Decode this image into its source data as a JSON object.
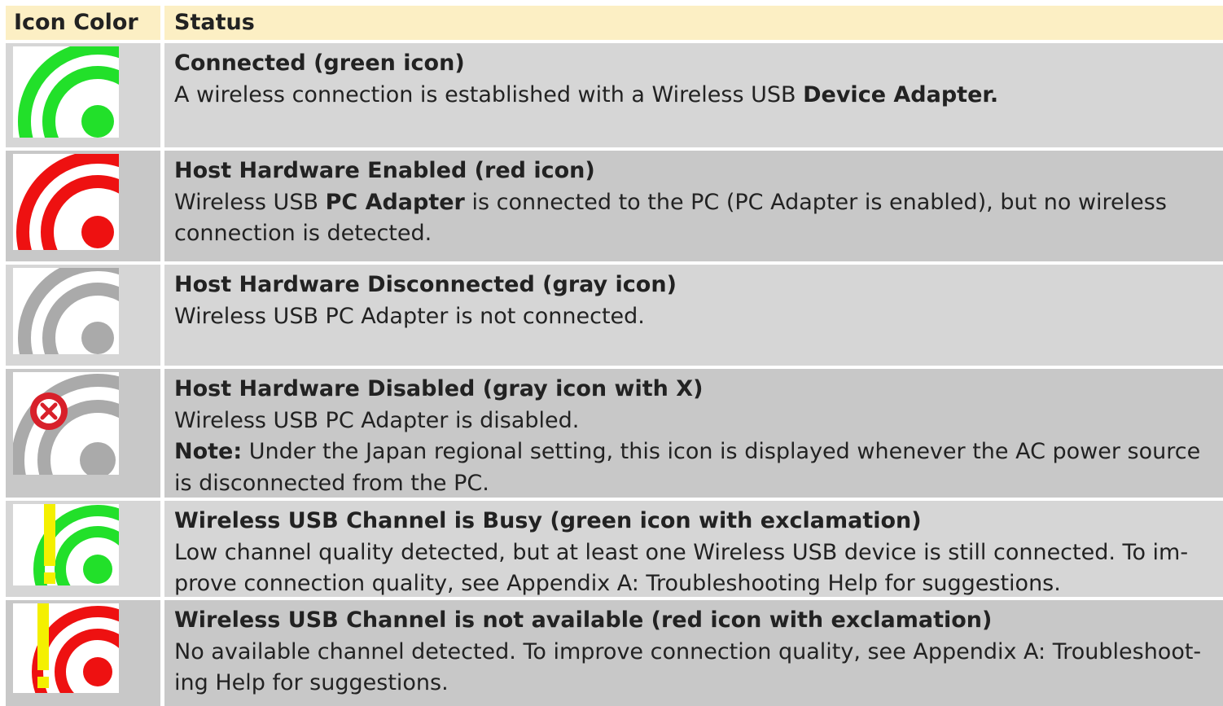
{
  "header": {
    "col1": "Icon Color",
    "col2": "Status"
  },
  "colors": {
    "green": "#22e02a",
    "red": "#ee1111",
    "gray": "#aaaaaa",
    "yellow": "#f4f000",
    "header_bg": "#fcefc4"
  },
  "rows": [
    {
      "icon": "green-wireless-icon",
      "title": "Connected (green icon)",
      "desc_a": "A wireless connection is established with a Wireless USB ",
      "desc_b": "Device Adapter."
    },
    {
      "icon": "red-wireless-icon",
      "title": "Host Hardware Enabled (red icon)",
      "desc_a": "Wireless USB ",
      "desc_b": "PC Adapter",
      "desc_c": " is connected to the PC (PC Adapter is enabled), but no wireless connection is detected."
    },
    {
      "icon": "gray-wireless-icon",
      "title": "Host Hardware Disconnected (gray icon)",
      "desc_a": "Wireless USB PC Adapter is not connected."
    },
    {
      "icon": "gray-wireless-x-icon",
      "title": "Host Hardware Disabled (gray icon with X)",
      "desc_a": "Wireless USB PC Adapter is disabled.",
      "note_label": "Note:",
      "note_text": " Under the Japan regional setting, this icon is displayed whenever the AC power source is disconnected from the PC."
    },
    {
      "icon": "green-wireless-exclamation-icon",
      "title": "Wireless USB Channel is Busy (green icon with exclamation)",
      "desc_a": "Low channel quality detected, but at least one Wireless USB device is still connected. To im-",
      "desc_b": "prove connection quality, see Appendix A: Troubleshooting Help for suggestions."
    },
    {
      "icon": "red-wireless-exclamation-icon",
      "title": "Wireless USB Channel is not available (red icon with exclamation)",
      "desc_a": "No available channel detected. To improve connection quality, see Appendix A: Troubleshoot-",
      "desc_b": "ing Help for suggestions."
    }
  ]
}
